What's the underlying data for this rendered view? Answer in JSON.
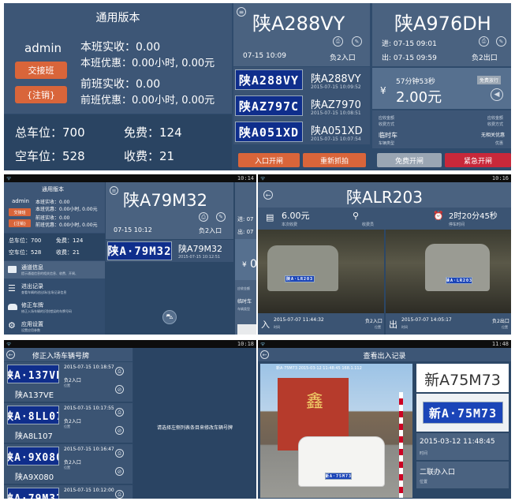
{
  "p1": {
    "version": "通用版本",
    "user": "admin",
    "handover_btn": "交接班",
    "logout_btn": "{注销}",
    "cur_received": "本班实收：0.00",
    "cur_discount": "本班优惠：0.00小时, 0.00元",
    "prev_received": "前班实收：0.00",
    "prev_discount": "前班优惠：0.00小时, 0.00元",
    "total_spaces": "总车位：700",
    "free_count": "免费：124",
    "empty_spaces": "空车位：528",
    "paid_count": "收费：21",
    "entry_plate": "陕A288VY",
    "entry_time": "07-15 10:09",
    "entry_gate": "负2入口",
    "exit_plate": "陕A976DH",
    "exit_in_time": "进: 07-15 09:01",
    "exit_out_time": "出: 07-15 09:59",
    "exit_gate": "负2出口",
    "duration": "57分钟53秒",
    "price": "2.00元",
    "currency": "¥",
    "free_pass_tag": "免费放行",
    "fee_label": "应收金额",
    "fee_method_label": "收费方式",
    "fee_value": "应收金额",
    "fee_method_value": "收费方式",
    "car_type": "临时车",
    "car_type_label": "车辆类型",
    "discount_value": "无相关优惠",
    "discount_label": "优惠",
    "recent": [
      {
        "plate": "陕A288VY",
        "name": "陕A288VY",
        "time": "2015-07-15 10:09:52"
      },
      {
        "plate": "陕AZ797C",
        "name": "陕AZ7970",
        "time": "2015-07-15 10:08:51"
      },
      {
        "plate": "陕A051XD",
        "name": "陕A051XD",
        "time": "2015-07-15 10:07:54"
      }
    ],
    "btn_open_entry": "入口开闸",
    "btn_recapture": "重新抓拍",
    "btn_free": "免费开闸",
    "btn_emergency": "紧急开闸"
  },
  "p2": {
    "status_time": "10:14",
    "version": "通用版本",
    "user": "admin",
    "handover_btn": "交接班",
    "logout_btn": "{注销}",
    "cur_received": "本班实收：0.00",
    "cur_discount": "本班优惠：0.00小时, 0.00元",
    "prev_received": "前班实收：0.00",
    "prev_discount": "前班优惠：0.00小时, 0.00元",
    "total_spaces": "总车位：700",
    "free_count": "免费：124",
    "empty_spaces": "空车位：528",
    "paid_count": "收费：21",
    "menu": [
      {
        "title": "通道信息",
        "sub": "提示通道信息的相关信息、收费、开闸、"
      },
      {
        "title": "进出记录",
        "sub": "查看车辆的进出场/出场记录信息"
      },
      {
        "title": "修正车牌",
        "sub": "修正入场车辆的识别错误的车牌号码"
      },
      {
        "title": "应用设置",
        "sub": "设置应用参数"
      }
    ],
    "entry_plate": "陕A79M32",
    "entry_time": "07-15 10:12",
    "entry_gate": "负2入口",
    "thumb_plate": "陕A·79M32",
    "list_name": "陕A79M32",
    "list_time": "2015-07-15 10:12:51",
    "peek_in": "进: 07",
    "peek_out": "出: 07",
    "peek_fee_label": "应收金额",
    "peek_car": "临时车",
    "peek_car_label": "车辆类型",
    "peek_currency": "¥",
    "peek_zero": "0"
  },
  "p3": {
    "status_time": "10:16",
    "plate": "陕ALR203",
    "fee": "6.00元",
    "fee_label": "本次收费",
    "operator_label": "收费员",
    "duration": "2时20分45秒",
    "duration_label": "停车时间",
    "photo1_plate": "陕A·LR203",
    "photo2_plate": "陕A·LR203",
    "in_label": "入",
    "in_time": "2015-07-07 11:44:32",
    "in_time_label": "时间",
    "in_gate": "负2入口",
    "in_gate_label": "位置",
    "out_label": "出",
    "out_time": "2015-07-07 14:05:17",
    "out_time_label": "时间",
    "out_gate": "负2出口",
    "out_gate_label": "位置"
  },
  "p4": {
    "status_time": "10:18",
    "title": "修正入场车辆号牌",
    "hint": "请选择左侧列表条目来修改车辆号牌",
    "items": [
      {
        "plate": "陕A·137VE",
        "name": "陕A137VE",
        "time": "2015-07-15 10:18:57",
        "gate": "负2入口",
        "gate_label": "位置"
      },
      {
        "plate": "陕A·8LL07",
        "name": "陕A8L107",
        "time": "2015-07-15 10:17:55",
        "gate": "负2入口",
        "gate_label": "位置"
      },
      {
        "plate": "陕A·9X080",
        "name": "陕A9X080",
        "time": "2015-07-15 10:16:47",
        "gate": "负2入口",
        "gate_label": "位置"
      },
      {
        "plate": "陕A·79M32",
        "name": "",
        "time": "2015-07-15 10:12:00",
        "gate": "",
        "gate_label": ""
      }
    ]
  },
  "p5": {
    "status_time": "11:48",
    "title": "查看出入记录",
    "plate": "新A75M73",
    "plate_img": "新A·75M73",
    "photo_plate": "新A·75M73",
    "time": "2015-03-12 11:48:45",
    "time_label": "时间",
    "gate": "二联办入口",
    "gate_label": "位置",
    "photo_sign": "鑫",
    "photo_overlay": "新A·75M73 2015-03-12 11:48:45 168.1.112"
  }
}
